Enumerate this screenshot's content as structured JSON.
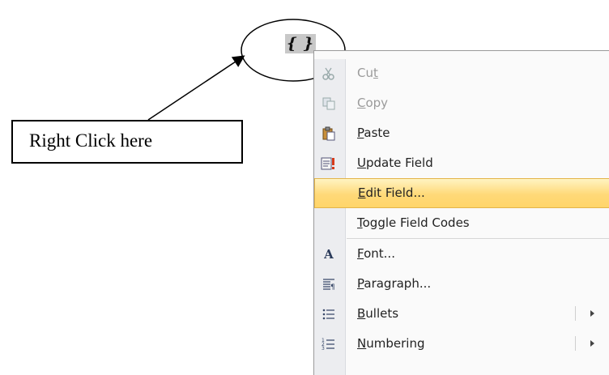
{
  "field_code": {
    "text": "{ }"
  },
  "callout": {
    "text": "Right Click here"
  },
  "menu": {
    "items": [
      {
        "label_pre": "Cu",
        "mnemonic": "t",
        "label_post": "",
        "icon": "scissors-icon",
        "enabled": false
      },
      {
        "label_pre": "",
        "mnemonic": "C",
        "label_post": "opy",
        "icon": "copy-icon",
        "enabled": false
      },
      {
        "label_pre": "",
        "mnemonic": "P",
        "label_post": "aste",
        "icon": "paste-icon",
        "enabled": true
      },
      {
        "label_pre": "",
        "mnemonic": "U",
        "label_post": "pdate Field",
        "icon": "update-field-icon",
        "enabled": true
      },
      {
        "label_pre": "",
        "mnemonic": "E",
        "label_post": "dit Field...",
        "icon": "",
        "enabled": true,
        "highlighted": true
      },
      {
        "label_pre": "",
        "mnemonic": "T",
        "label_post": "oggle Field Codes",
        "icon": "",
        "enabled": true
      },
      {
        "label_pre": "",
        "mnemonic": "F",
        "label_post": "ont...",
        "icon": "font-icon",
        "enabled": true
      },
      {
        "label_pre": "",
        "mnemonic": "P",
        "label_post": "aragraph...",
        "icon": "paragraph-icon",
        "enabled": true
      },
      {
        "label_pre": "",
        "mnemonic": "B",
        "label_post": "ullets",
        "icon": "bullets-icon",
        "enabled": true,
        "submenu": true
      },
      {
        "label_pre": "",
        "mnemonic": "N",
        "label_post": "umbering",
        "icon": "numbering-icon",
        "enabled": true,
        "submenu": true
      }
    ]
  },
  "colors": {
    "highlight": "#ffd978",
    "gutter": "#ecedf0"
  }
}
